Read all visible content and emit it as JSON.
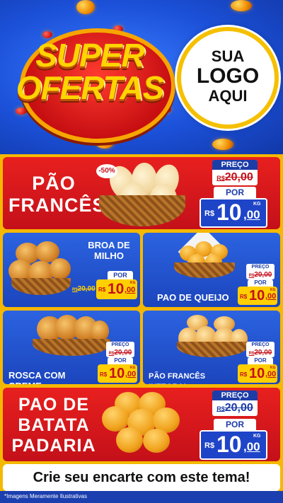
{
  "header": {
    "title_line1": "SUPER",
    "title_line2": "OFERTAS",
    "logo": {
      "line1": "SUA",
      "line2": "LOGO",
      "line3": "AQUI"
    }
  },
  "labels": {
    "preco": "PREÇO",
    "por": "POR",
    "currency": "R$",
    "unit": "KG"
  },
  "products": [
    {
      "name_lines": [
        "PÃO",
        "FRANCÊS"
      ],
      "old_price": "20,00",
      "price_int": "10",
      "price_dec": ",00",
      "badge": "-50%"
    },
    {
      "name_lines": [
        "BROA DE",
        "MILHO"
      ],
      "old_price": "20,00",
      "price_int": "10",
      "price_dec": ",00"
    },
    {
      "name_lines": [
        "PAO DE QUEIJO"
      ],
      "old_price": "20,00",
      "price_int": "10",
      "price_dec": ",00"
    },
    {
      "name_lines": [
        "ROSCA COM CREME"
      ],
      "old_price": "20,00",
      "price_int": "10",
      "price_dec": ",00"
    },
    {
      "name_lines": [
        "PÃO FRANCÊS INTEGRAL"
      ],
      "old_price": "20,00",
      "price_int": "10",
      "price_dec": ",00"
    },
    {
      "name_lines": [
        "PAO DE",
        "BATATA",
        "PADARIA"
      ],
      "old_price": "20,00",
      "price_int": "10",
      "price_dec": ",00"
    }
  ],
  "footer": {
    "cta": "Crie seu encarte com este tema!",
    "note": "*Imagens Meramente Ilustrativas"
  },
  "colors": {
    "red": "#c4101a",
    "blue": "#1c3ca8",
    "yellow": "#f5b800"
  }
}
